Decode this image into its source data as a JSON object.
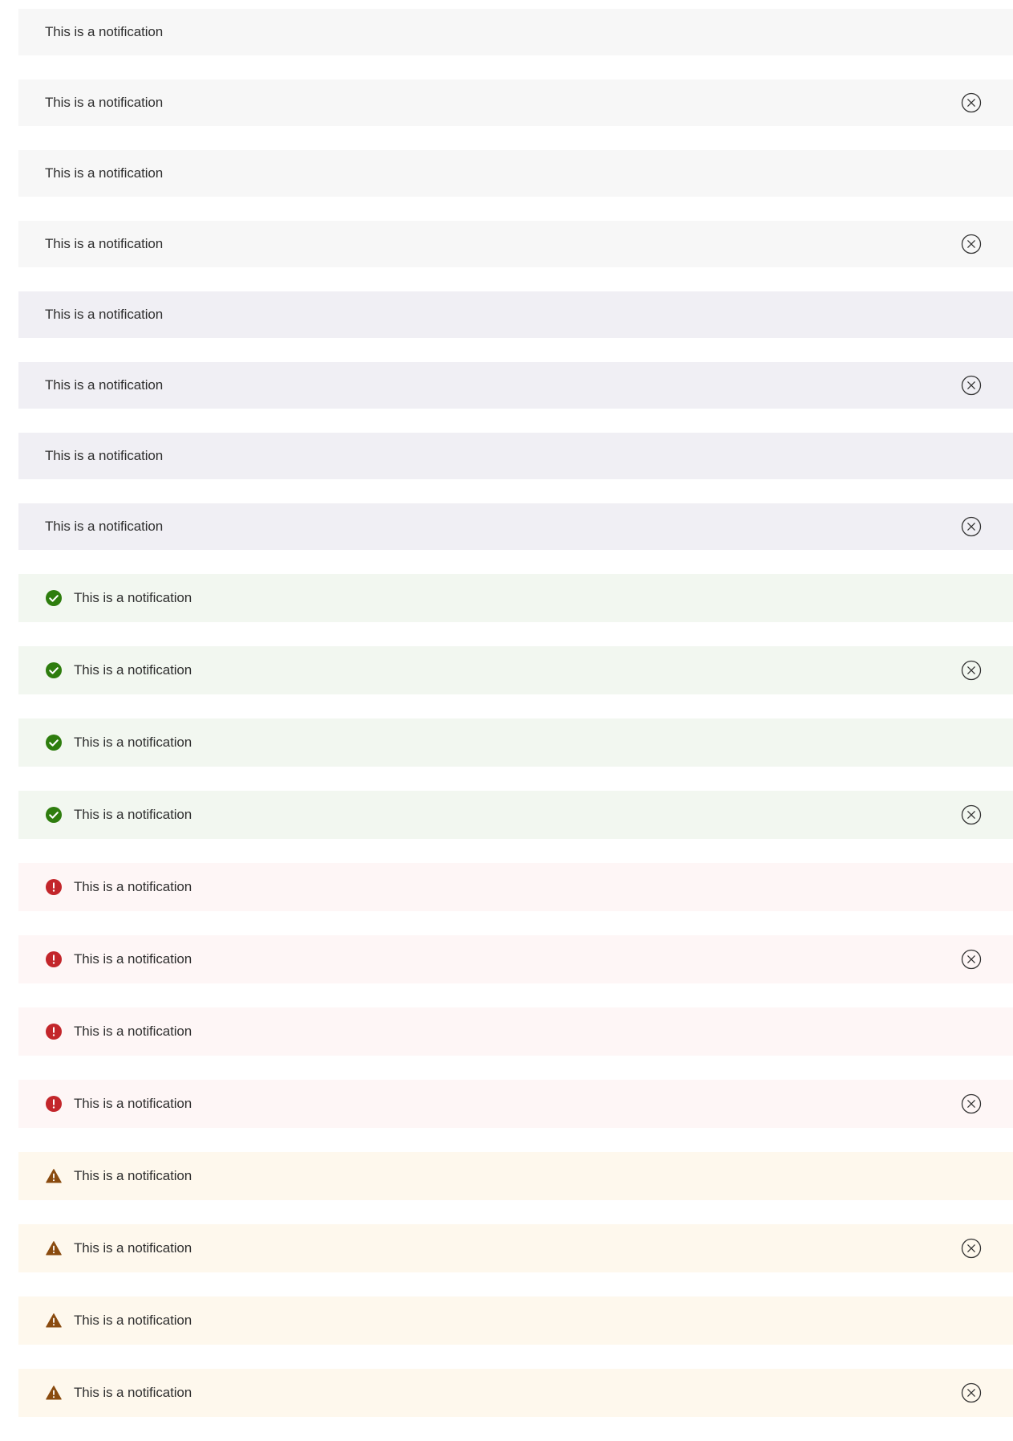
{
  "notifications": [
    {
      "variant": "neutral",
      "message": "This is a notification",
      "dismissible": false,
      "icon": ""
    },
    {
      "variant": "neutral",
      "message": "This is a notification",
      "dismissible": true,
      "icon": ""
    },
    {
      "variant": "neutral",
      "message": "This is a notification",
      "dismissible": false,
      "icon": ""
    },
    {
      "variant": "neutral",
      "message": "This is a notification",
      "dismissible": true,
      "icon": ""
    },
    {
      "variant": "info",
      "message": "This is a notification",
      "dismissible": false,
      "icon": ""
    },
    {
      "variant": "info",
      "message": "This is a notification",
      "dismissible": true,
      "icon": ""
    },
    {
      "variant": "info",
      "message": "This is a notification",
      "dismissible": false,
      "icon": ""
    },
    {
      "variant": "info",
      "message": "This is a notification",
      "dismissible": true,
      "icon": ""
    },
    {
      "variant": "success",
      "message": "This is a notification",
      "dismissible": false,
      "icon": "success-check-icon"
    },
    {
      "variant": "success",
      "message": "This is a notification",
      "dismissible": true,
      "icon": "success-check-icon"
    },
    {
      "variant": "success",
      "message": "This is a notification",
      "dismissible": false,
      "icon": "success-check-icon"
    },
    {
      "variant": "success",
      "message": "This is a notification",
      "dismissible": true,
      "icon": "success-check-icon"
    },
    {
      "variant": "error",
      "message": "This is a notification",
      "dismissible": false,
      "icon": "error-alert-icon"
    },
    {
      "variant": "error",
      "message": "This is a notification",
      "dismissible": true,
      "icon": "error-alert-icon"
    },
    {
      "variant": "error",
      "message": "This is a notification",
      "dismissible": false,
      "icon": "error-alert-icon"
    },
    {
      "variant": "error",
      "message": "This is a notification",
      "dismissible": true,
      "icon": "error-alert-icon"
    },
    {
      "variant": "warning",
      "message": "This is a notification",
      "dismissible": false,
      "icon": "warning-triangle-icon"
    },
    {
      "variant": "warning",
      "message": "This is a notification",
      "dismissible": true,
      "icon": "warning-triangle-icon"
    },
    {
      "variant": "warning",
      "message": "This is a notification",
      "dismissible": false,
      "icon": "warning-triangle-icon"
    },
    {
      "variant": "warning",
      "message": "This is a notification",
      "dismissible": true,
      "icon": "warning-triangle-icon"
    }
  ],
  "colors": {
    "neutral_bg": "#f7f7f7",
    "info_bg": "#f0eff4",
    "success_bg": "#f2f7f0",
    "success_icon": "#2e7d0e",
    "error_bg": "#fef6f6",
    "error_icon": "#c3262b",
    "warning_bg": "#fef8ed",
    "warning_icon": "#8a4b0f",
    "text": "#2f2f2f",
    "close_icon": "#333333"
  },
  "close_icon": "close-circle-icon"
}
